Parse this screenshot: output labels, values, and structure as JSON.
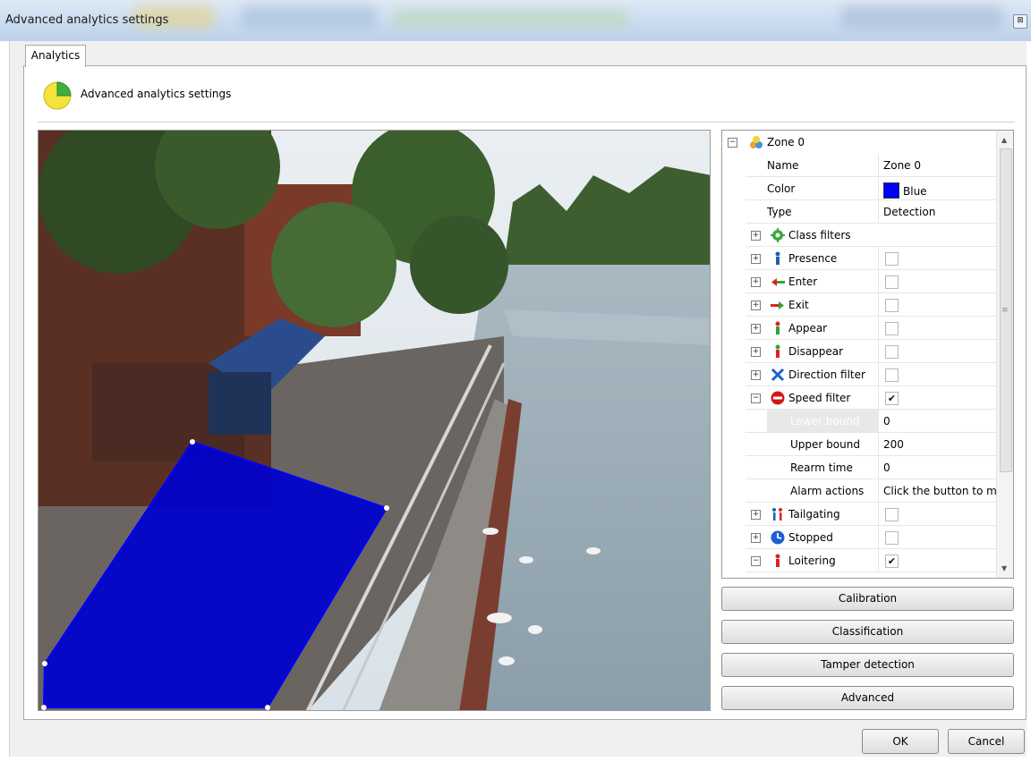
{
  "window": {
    "title": "Advanced analytics settings",
    "close_glyph": "⊠"
  },
  "tabs": [
    {
      "label": "Analytics",
      "active": true
    }
  ],
  "header": {
    "title": "Advanced analytics settings",
    "icon": "pie-chart-icon"
  },
  "zone_overlay": {
    "color": "#0000ff",
    "opacity": 0.85
  },
  "property_grid": {
    "zone": {
      "label": "Zone 0",
      "icon": "zone-icon",
      "expanded": true
    },
    "properties": [
      {
        "label": "Name",
        "value": "Zone 0"
      },
      {
        "label": "Color",
        "value": "Blue",
        "swatch": "#0000ff"
      },
      {
        "label": "Type",
        "value": "Detection"
      }
    ],
    "filters": [
      {
        "label": "Class filters",
        "icon": "gear-icon",
        "expanded": false
      },
      {
        "label": "Presence",
        "icon": "person-icon",
        "checked": false,
        "expanded": false
      },
      {
        "label": "Enter",
        "icon": "enter-arrow-icon",
        "checked": false,
        "expanded": false
      },
      {
        "label": "Exit",
        "icon": "exit-arrow-icon",
        "checked": false,
        "expanded": false
      },
      {
        "label": "Appear",
        "icon": "appear-icon",
        "checked": false,
        "expanded": false
      },
      {
        "label": "Disappear",
        "icon": "disappear-icon",
        "checked": false,
        "expanded": false
      },
      {
        "label": "Direction filter",
        "icon": "direction-icon",
        "checked": false,
        "expanded": false
      },
      {
        "label": "Speed filter",
        "icon": "speed-icon",
        "checked": true,
        "expanded": true
      }
    ],
    "speed_sub": [
      {
        "label": "Lower bound",
        "value": "0",
        "selected": true
      },
      {
        "label": "Upper bound",
        "value": "200"
      },
      {
        "label": "Rearm time",
        "value": "0"
      },
      {
        "label": "Alarm actions",
        "value": "Click the button to mo"
      }
    ],
    "filters_after": [
      {
        "label": "Tailgating",
        "icon": "tailgating-icon",
        "checked": false,
        "expanded": false
      },
      {
        "label": "Stopped",
        "icon": "clock-icon",
        "checked": false,
        "expanded": false
      },
      {
        "label": "Loitering",
        "icon": "loitering-icon",
        "checked": true,
        "expanded": true
      }
    ]
  },
  "side_buttons": [
    "Calibration",
    "Classification",
    "Tamper detection",
    "Advanced"
  ],
  "dialog_buttons": {
    "ok": "OK",
    "cancel": "Cancel"
  },
  "glyphs": {
    "minus": "−",
    "plus": "+",
    "check": "✔",
    "up": "▲",
    "down": "▼",
    "grip": "≡"
  }
}
